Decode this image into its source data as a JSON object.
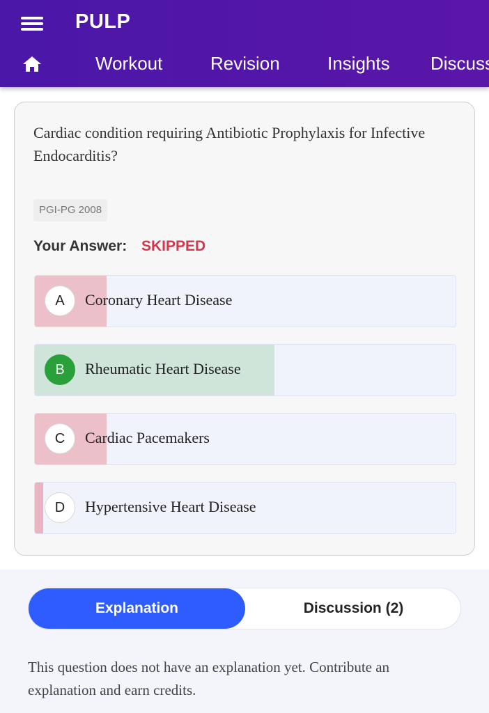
{
  "header": {
    "title": "PULP",
    "menu_icon": "hamburger-menu-icon",
    "home_icon": "home-icon",
    "tabs": [
      {
        "label": "Workout"
      },
      {
        "label": "Revision"
      },
      {
        "label": "Insights"
      },
      {
        "label": "Discuss"
      }
    ],
    "colors": {
      "background": "#4a17a8",
      "text": "#ffffff"
    }
  },
  "question": {
    "text": "Cardiac condition requiring Antibiotic Prophylaxis for Infective Endocarditis?",
    "tag": "PGI-PG 2008",
    "your_answer_label": "Your Answer:",
    "your_answer_value": "SKIPPED",
    "options": [
      {
        "letter": "A",
        "text": "Coronary Heart Disease",
        "fill_fraction": 0.17,
        "fill_color": "#ebc0c8",
        "correct": false
      },
      {
        "letter": "B",
        "text": "Rheumatic Heart Disease",
        "fill_fraction": 0.57,
        "fill_color": "#cfe5d9",
        "correct": true
      },
      {
        "letter": "C",
        "text": "Cardiac Pacemakers",
        "fill_fraction": 0.17,
        "fill_color": "#ebc0c8",
        "correct": false
      },
      {
        "letter": "D",
        "text": "Hypertensive Heart Disease",
        "fill_fraction": 0.02,
        "fill_color": "#e8b5c0",
        "correct": false
      }
    ],
    "colors": {
      "skipped": "#d6364a",
      "correct": "#2aa03a"
    }
  },
  "explanation": {
    "tabs": {
      "explanation": "Explanation",
      "discussion": "Discussion (2)"
    },
    "active_tab": "explanation",
    "text": "This question does not have an explanation yet. Contribute an explanation and earn credits.",
    "colors": {
      "active": "#2f5cff"
    }
  }
}
